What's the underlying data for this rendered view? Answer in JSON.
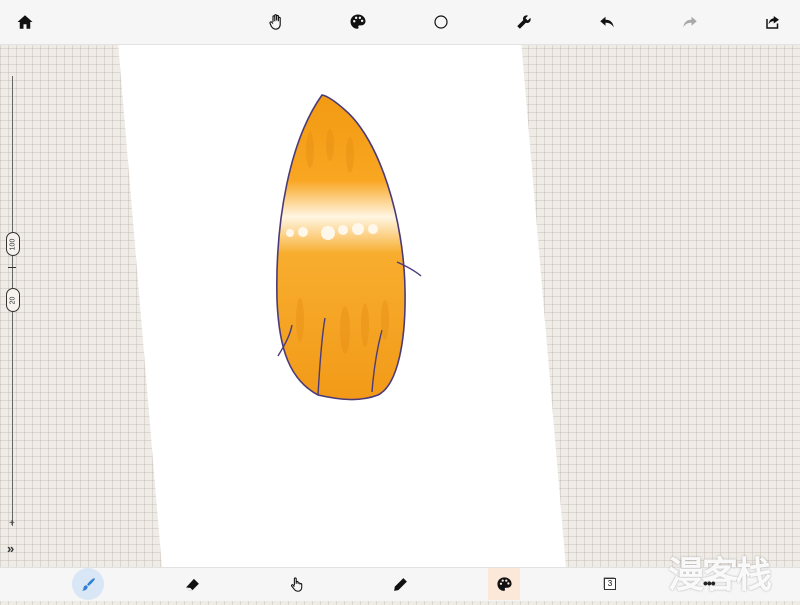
{
  "toolbar": {
    "home_icon": "home-icon",
    "pan_icon": "hand-icon",
    "color_icon": "palette-icon",
    "shape_icon": "circle-icon",
    "tools_icon": "wrench-icon",
    "undo_icon": "undo-icon",
    "redo_icon": "redo-icon",
    "share_icon": "share-icon"
  },
  "side_slider": {
    "size_value": "100",
    "opacity_value": "20",
    "plus": "+",
    "minus": "–",
    "expand": "»"
  },
  "bottom_toolbar": {
    "brush_icon": "brush-icon",
    "eraser_icon": "eraser-icon",
    "smudge_icon": "finger-icon",
    "pencil_icon": "pencil-icon",
    "palette_icon": "palette-icon",
    "layers_count": "3",
    "more": "•••"
  },
  "watermark": "漫客栈",
  "colors": {
    "hair_fill": "#f7a21c",
    "hair_outline": "#4a3a7a",
    "paper": "#ffffff",
    "workspace": "#efebe6",
    "active_brush_bg": "#d8e6f5",
    "active_palette_bg": "#fbe8d8"
  }
}
